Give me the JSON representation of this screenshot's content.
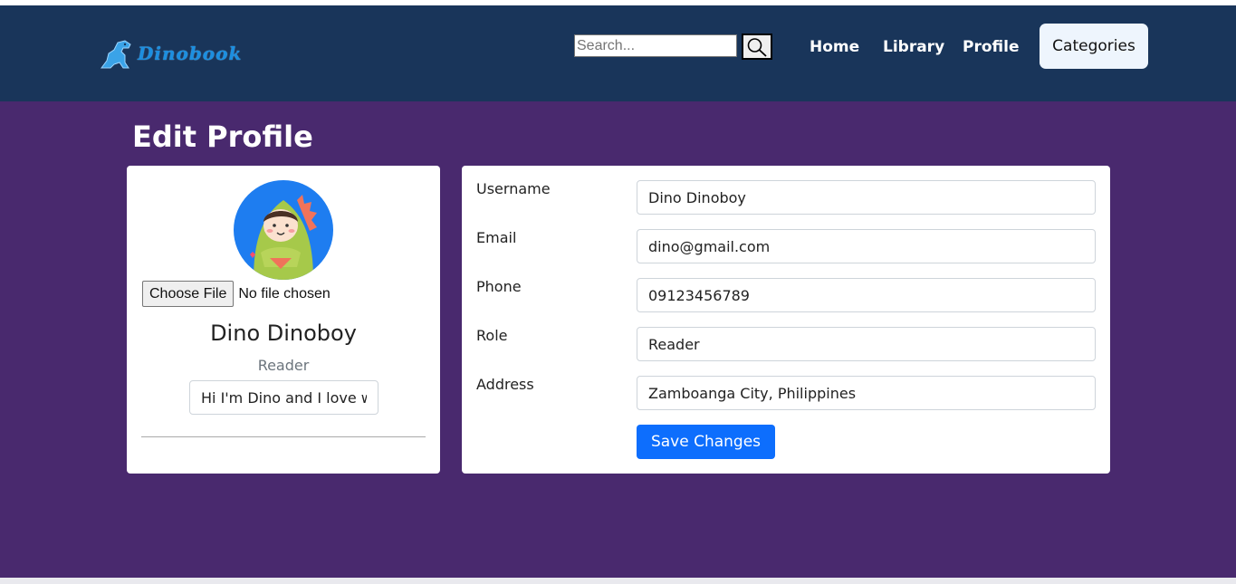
{
  "brand": {
    "logo_text": "Dinobook"
  },
  "search": {
    "placeholder": "Search..."
  },
  "nav": {
    "home": "Home",
    "library": "Library",
    "profile": "Profile",
    "categories": "Categories"
  },
  "page": {
    "title": "Edit Profile"
  },
  "profile_card": {
    "file_button": "Choose File",
    "file_status": "No file chosen",
    "name": "Dino Dinoboy",
    "role": "Reader",
    "bio": "Hi I'm Dino and I love wa"
  },
  "form": {
    "fields": [
      {
        "label": "Username",
        "value": "Dino Dinoboy"
      },
      {
        "label": "Email",
        "value": "dino@gmail.com"
      },
      {
        "label": "Phone",
        "value": "09123456789"
      },
      {
        "label": "Role",
        "value": "Reader"
      },
      {
        "label": "Address",
        "value": "Zamboanga City, Philippines"
      }
    ],
    "save_label": "Save Changes"
  },
  "colors": {
    "navbar": "#19355a",
    "main_bg": "#49296e",
    "primary": "#0d6efd",
    "avatar_bg": "#1e7df0"
  }
}
